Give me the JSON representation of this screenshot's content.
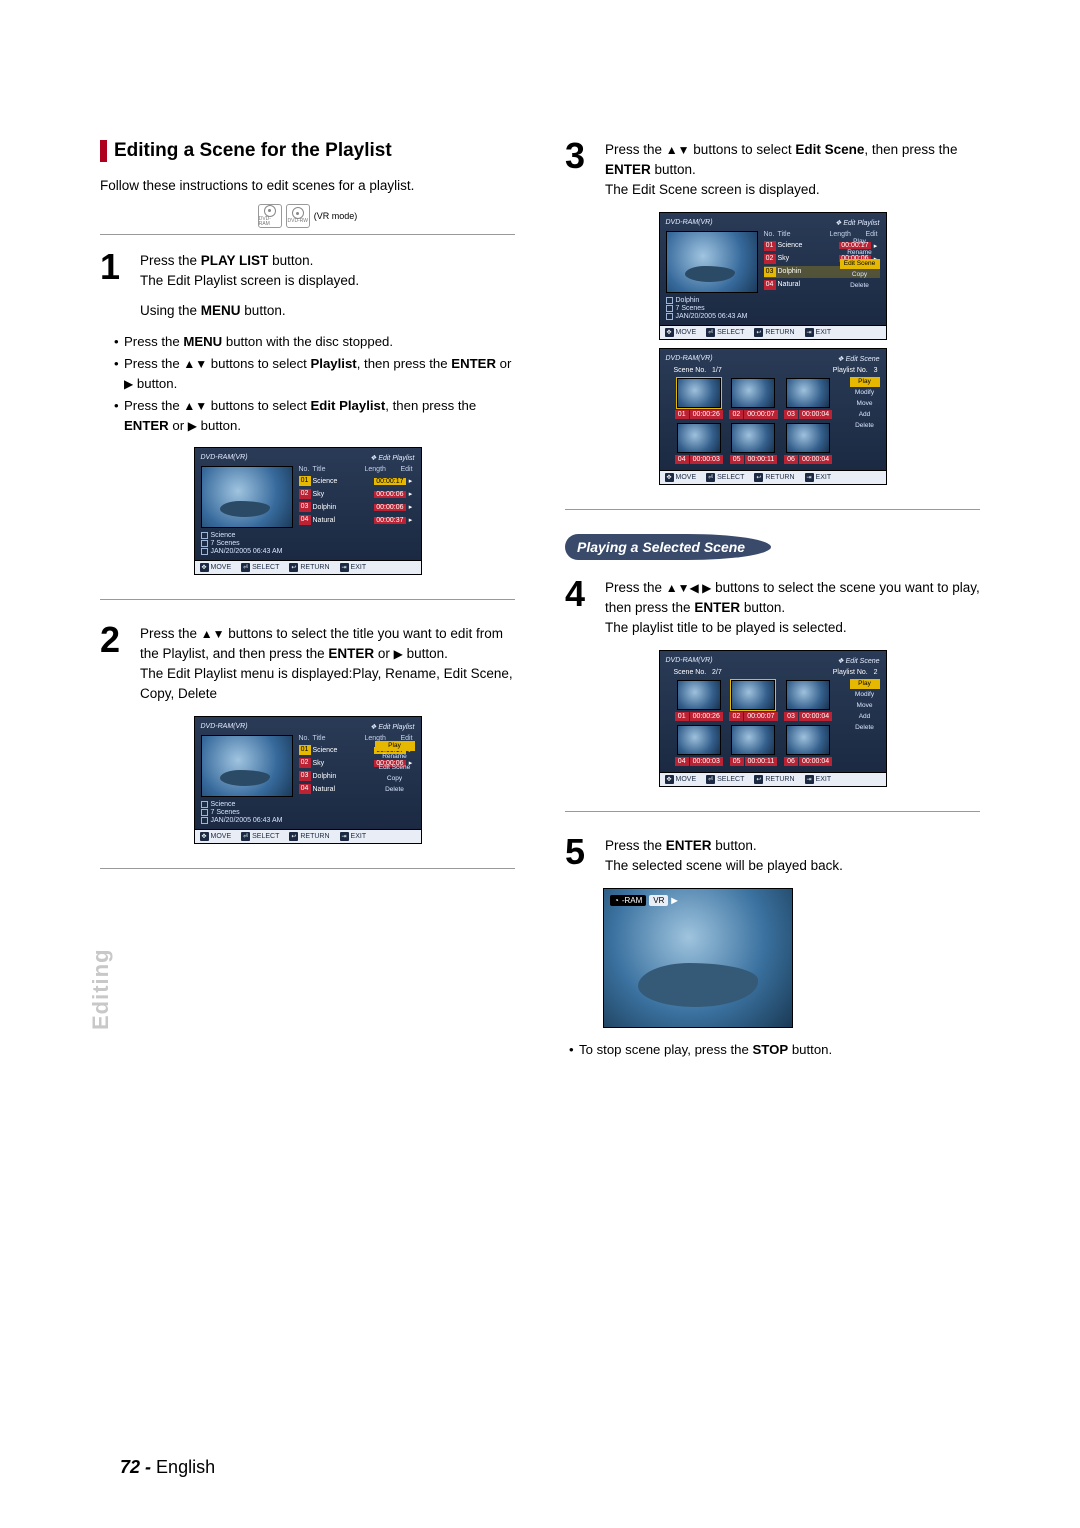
{
  "section_title": "Editing a Scene for the Playlist",
  "intro": "Follow these instructions to edit scenes for a playlist.",
  "vr_mode_label": "(VR mode)",
  "disc_labels": [
    "DVD-RAM",
    "DVD-RW"
  ],
  "side_tab": "Editing",
  "steps": {
    "s1": {
      "num": "1",
      "text_a": "Press the ",
      "text_b": "PLAY LIST",
      "text_c": " button.",
      "text_d": "The Edit Playlist screen is displayed.",
      "using_menu": "Using the ",
      "using_menu_b": "MENU",
      "using_menu_c": " button.",
      "b1a": "Press the ",
      "b1b": "MENU",
      "b1c": " button with the disc stopped.",
      "b2a": "Press the ",
      "b2arr": "▲▼",
      "b2b": " buttons to select ",
      "b2c": "Playlist",
      "b2d": ", then press the ",
      "b2e": "ENTER",
      "b2f": " or ",
      "b2play": "▶",
      "b2g": " button.",
      "b3a": "Press the ",
      "b3arr": "▲▼",
      "b3b": " buttons to select ",
      "b3c": "Edit Playlist",
      "b3d": ", then press the ",
      "b3e": "ENTER",
      "b3f": " or ",
      "b3play": "▶",
      "b3g": " button."
    },
    "s2": {
      "num": "2",
      "a": "Press the ",
      "arr": "▲▼",
      "b": " buttons to select the title you want to edit from the Playlist, and then press the ",
      "c": "ENTER",
      "d": " or ",
      "play": "▶",
      "e": " button.",
      "f": "The Edit Playlist menu is displayed:Play, Rename, Edit Scene, Copy, Delete"
    },
    "s3": {
      "num": "3",
      "a": "Press the ",
      "arr": "▲▼",
      "b": " buttons to select ",
      "c": "Edit Scene",
      "d": ", then press the ",
      "e": "ENTER",
      "f": " button.",
      "g": "The Edit Scene screen is displayed."
    },
    "s4": {
      "num": "4",
      "a": "Press the ",
      "arr": "▲▼◀ ▶",
      "b": "  buttons to select the scene you want to play, then press the ",
      "c": "ENTER",
      "d": " button.",
      "e": "The playlist title to be played is selected."
    },
    "s5": {
      "num": "5",
      "a": "Press the ",
      "b": "ENTER",
      "c": " button.",
      "d": "The selected scene will be played back."
    }
  },
  "subsection_title": "Playing a Selected Scene",
  "stop_note_a": "To stop scene play, press the ",
  "stop_note_b": "STOP",
  "stop_note_c": " button.",
  "footer_page": "72 -",
  "footer_lang": "English",
  "osd_common": {
    "mode": "DVD-RAM(VR)",
    "nav": {
      "move": "MOVE",
      "select": "SELECT",
      "return": "RETURN",
      "exit": "EXIT"
    }
  },
  "osd_playlist": {
    "breadcrumb": "Edit Playlist",
    "headers": {
      "no": "No.",
      "title": "Title",
      "length": "Length",
      "edit": "Edit"
    },
    "items": [
      {
        "no": "01",
        "title": "Science",
        "length": "00:00:17"
      },
      {
        "no": "02",
        "title": "Sky",
        "length": "00:00:06"
      },
      {
        "no": "03",
        "title": "Dolphin",
        "length": "00:00:06"
      },
      {
        "no": "04",
        "title": "Natural",
        "length": "00:00:37"
      }
    ],
    "info": {
      "name": "Science",
      "scenes": "7 Scenes",
      "date": "JAN/20/2005 06:43 AM"
    },
    "selected_index": 0
  },
  "osd_playlist_menu": {
    "breadcrumb": "Edit Playlist",
    "info": {
      "name": "Science",
      "scenes": "7 Scenes",
      "date": "JAN/20/2005 06:43 AM"
    },
    "items": [
      {
        "no": "01",
        "title": "Science",
        "length": "00:00:17"
      },
      {
        "no": "02",
        "title": "Sky",
        "length": "00:00:06"
      },
      {
        "no": "03",
        "title": "Dolphin"
      },
      {
        "no": "04",
        "title": "Natural"
      }
    ],
    "menu": [
      "Play",
      "Rename",
      "Edit Scene",
      "Copy",
      "Delete"
    ],
    "highlight": 0
  },
  "osd_editscene_info": {
    "breadcrumb": "Edit Playlist",
    "info": {
      "name": "Dolphin",
      "scenes": "7 Scenes",
      "date": "JAN/20/2005 06:43 AM"
    },
    "items": [
      {
        "no": "01",
        "title": "Science",
        "length": "00:00:17"
      },
      {
        "no": "02",
        "title": "Sky",
        "length": "00:00:06"
      },
      {
        "no": "03",
        "title": "Dolphin"
      },
      {
        "no": "04",
        "title": "Natural"
      }
    ],
    "menu": [
      "Play",
      "Rename",
      "Edit Scene",
      "Copy",
      "Delete"
    ],
    "highlight": 2
  },
  "osd_scene_grid_a": {
    "breadcrumb": "Edit Scene",
    "scene_no_label": "Scene No.",
    "scene_no": "1/7",
    "playlist_no_label": "Playlist No.",
    "playlist_no": "3",
    "cells": [
      {
        "no": "01",
        "t": "00:00:26"
      },
      {
        "no": "02",
        "t": "00:00:07"
      },
      {
        "no": "03",
        "t": "00:00:04"
      },
      {
        "no": "04",
        "t": "00:00:03"
      },
      {
        "no": "05",
        "t": "00:00:11"
      },
      {
        "no": "06",
        "t": "00:00:04"
      }
    ],
    "menu": [
      "Play",
      "Modify",
      "Move",
      "Add",
      "Delete"
    ],
    "highlight": 0,
    "selected": 0
  },
  "osd_scene_grid_b": {
    "breadcrumb": "Edit Scene",
    "scene_no_label": "Scene No.",
    "scene_no": "2/7",
    "playlist_no_label": "Playlist No.",
    "playlist_no": "2",
    "cells": [
      {
        "no": "01",
        "t": "00:00:26"
      },
      {
        "no": "02",
        "t": "00:00:07"
      },
      {
        "no": "03",
        "t": "00:00:04"
      },
      {
        "no": "04",
        "t": "00:00:03"
      },
      {
        "no": "05",
        "t": "00:00:11"
      },
      {
        "no": "06",
        "t": "00:00:04"
      }
    ],
    "menu": [
      "Play",
      "Modify",
      "Move",
      "Add",
      "Delete"
    ],
    "highlight": 0,
    "selected": 1
  },
  "playback_tag": {
    "disc": "-RAM",
    "mode": "VR",
    "play": "▶"
  }
}
